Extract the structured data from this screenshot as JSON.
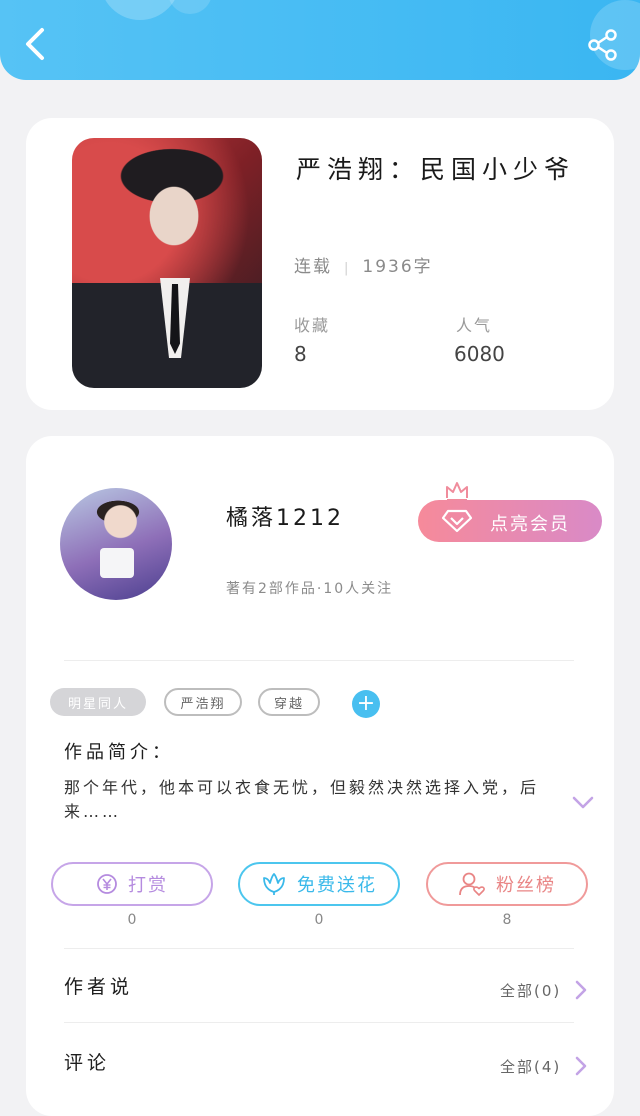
{
  "header": {
    "back_icon": "chevron-left-icon",
    "share_icon": "share-icon",
    "color": "#3ab6f2"
  },
  "book": {
    "title": "严浩翔：民国小少爷",
    "status": "连载",
    "word_count": "1936字",
    "favorites_label": "收藏",
    "favorites_value": "8",
    "popularity_label": "人气",
    "popularity_value": "6080"
  },
  "author": {
    "name": "橘落1212",
    "meta": "著有2部作品·10人关注",
    "vip_button": "点亮会员",
    "vip_icon": "diamond-icon",
    "crown_icon": "crown-icon"
  },
  "tags": [
    "明星同人",
    "严浩翔",
    "穿越"
  ],
  "intro": {
    "title": "作品简介：",
    "text": "那个年代，他本可以衣食无忧，但毅然决然选择入党，后来……",
    "expand_icon": "chevron-down-icon"
  },
  "actions": [
    {
      "label": "打赏",
      "icon": "yen-icon",
      "count": "0",
      "color": "#b58bdf"
    },
    {
      "label": "免费送花",
      "icon": "flower-icon",
      "count": "0",
      "color": "#3ab9ea"
    },
    {
      "label": "粉丝榜",
      "icon": "user-heart-icon",
      "count": "8",
      "color": "#e98585"
    }
  ],
  "sections": [
    {
      "label": "作者说",
      "link": "全部(0)"
    },
    {
      "label": "评论",
      "link": "全部(4)"
    }
  ]
}
